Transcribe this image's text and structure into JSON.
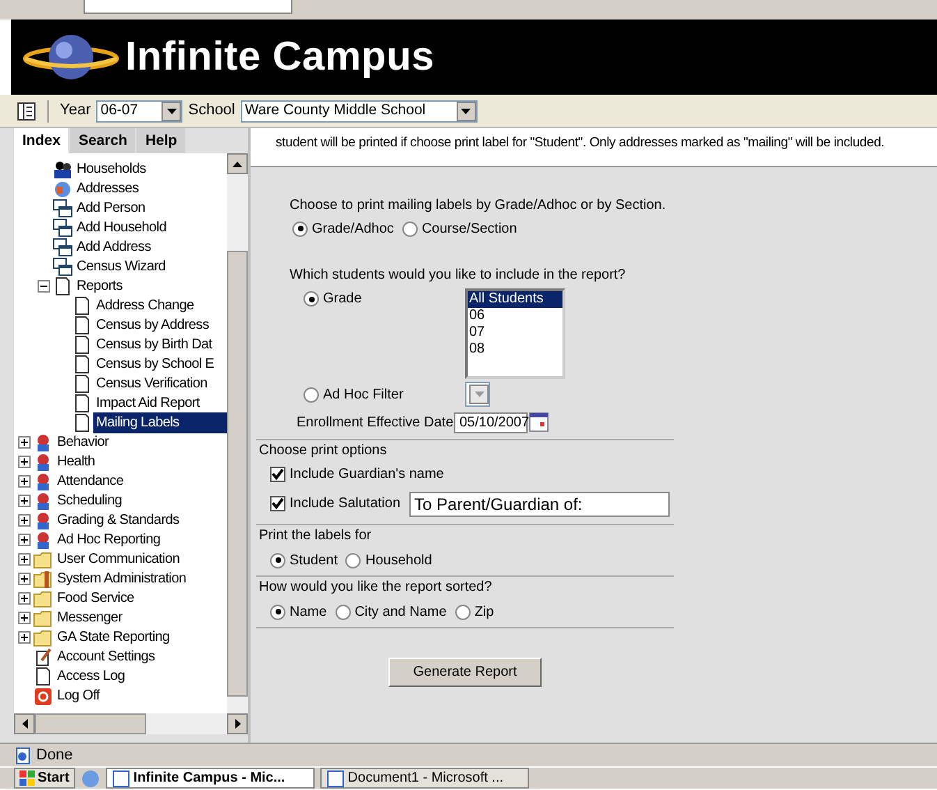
{
  "brand": {
    "title": "Infinite Campus"
  },
  "toolbar": {
    "year_label": "Year",
    "year": "06-07",
    "school_label": "School",
    "school": "Ware County Middle School"
  },
  "tabs": [
    {
      "label": "Index",
      "selected": true
    },
    {
      "label": "Search",
      "selected": false
    },
    {
      "label": "Help",
      "selected": false
    }
  ],
  "tree": [
    {
      "children": [
        {
          "label": "Households",
          "kind": "people",
          "selected": false
        },
        {
          "label": "Addresses",
          "kind": "globe",
          "selected": false
        },
        {
          "label": "Add Person",
          "kind": "window",
          "selected": false
        },
        {
          "label": "Add Household",
          "kind": "window",
          "selected": false
        },
        {
          "label": "Add Address",
          "kind": "window",
          "selected": false
        },
        {
          "label": "Census Wizard",
          "kind": "window",
          "selected": false
        },
        {
          "label": "Reports",
          "kind": "page",
          "selected": false,
          "expanded": true,
          "children": [
            {
              "label": "Address Change",
              "kind": "page",
              "selected": false
            },
            {
              "label": "Census by Address",
              "kind": "page",
              "selected": false
            },
            {
              "label": "Census by Birth Dat",
              "kind": "page",
              "selected": false
            },
            {
              "label": "Census by School E",
              "kind": "page",
              "selected": false
            },
            {
              "label": "Census Verification",
              "kind": "page",
              "selected": false
            },
            {
              "label": "Impact Aid Report",
              "kind": "page",
              "selected": false
            },
            {
              "label": "Mailing Labels",
              "kind": "page",
              "selected": true
            }
          ]
        }
      ]
    },
    {
      "label": "Behavior",
      "kind": "module",
      "selected": false,
      "expanded": false
    },
    {
      "label": "Health",
      "kind": "module",
      "selected": false,
      "expanded": false
    },
    {
      "label": "Attendance",
      "kind": "module",
      "selected": false,
      "expanded": false
    },
    {
      "label": "Scheduling",
      "kind": "module",
      "selected": false,
      "expanded": false
    },
    {
      "label": "Grading & Standards",
      "kind": "module",
      "selected": false,
      "expanded": false
    },
    {
      "label": "Ad Hoc Reporting",
      "kind": "module",
      "selected": false,
      "expanded": false
    },
    {
      "label": "User Communication",
      "kind": "folder",
      "selected": false,
      "expanded": false
    },
    {
      "label": "System Administration",
      "kind": "tools",
      "selected": false,
      "expanded": false
    },
    {
      "label": "Food Service",
      "kind": "folder",
      "selected": false,
      "expanded": false
    },
    {
      "label": "Messenger",
      "kind": "folder",
      "selected": false,
      "expanded": false
    },
    {
      "label": "GA State Reporting",
      "kind": "folder",
      "selected": false,
      "expanded": false
    },
    {
      "label": "Account Settings",
      "kind": "settings",
      "selected": false
    },
    {
      "label": "Access Log",
      "kind": "page",
      "selected": false
    },
    {
      "label": "Log Off",
      "kind": "logoff",
      "selected": false
    }
  ],
  "notice": "student will be printed if choose print label for \"Student\". Only addresses marked as \"mailing\" will be included.",
  "form": {
    "mode_prompt": "Choose to print mailing labels by Grade/Adhoc or by Section.",
    "mode": [
      {
        "label": "Grade/Adhoc",
        "selected": true
      },
      {
        "label": "Course/Section",
        "selected": false
      }
    ],
    "students_prompt": "Which students would you like to include in the report?",
    "grade_radio": {
      "label": "Grade",
      "selected": true
    },
    "grades": [
      {
        "label": "All Students",
        "selected": true
      },
      {
        "label": "06",
        "selected": false
      },
      {
        "label": "07",
        "selected": false
      },
      {
        "label": "08",
        "selected": false
      }
    ],
    "adhoc_radio": {
      "label": "Ad Hoc Filter",
      "selected": false
    },
    "date_label": "Enrollment Effective Date",
    "date": "05/10/2007",
    "print_options_title": "Choose print options",
    "guardian": {
      "label": "Include Guardian's name",
      "checked": true
    },
    "salutation": {
      "label": "Include Salutation",
      "checked": true,
      "value": "To Parent/Guardian of:"
    },
    "labels_for_title": "Print the labels for",
    "labels_for": [
      {
        "label": "Student",
        "selected": true
      },
      {
        "label": "Household",
        "selected": false
      }
    ],
    "sort_title": "How would you like the report sorted?",
    "sort": [
      {
        "label": "Name",
        "selected": true
      },
      {
        "label": "City and Name",
        "selected": false
      },
      {
        "label": "Zip",
        "selected": false
      }
    ],
    "submit": "Generate Report"
  },
  "status_bar": {
    "text": "Done"
  },
  "taskbar": {
    "start": "Start",
    "windows": [
      {
        "label": "Infinite Campus - Mic...",
        "selected": true
      },
      {
        "label": "Document1 - Microsoft ...",
        "selected": false
      }
    ]
  }
}
